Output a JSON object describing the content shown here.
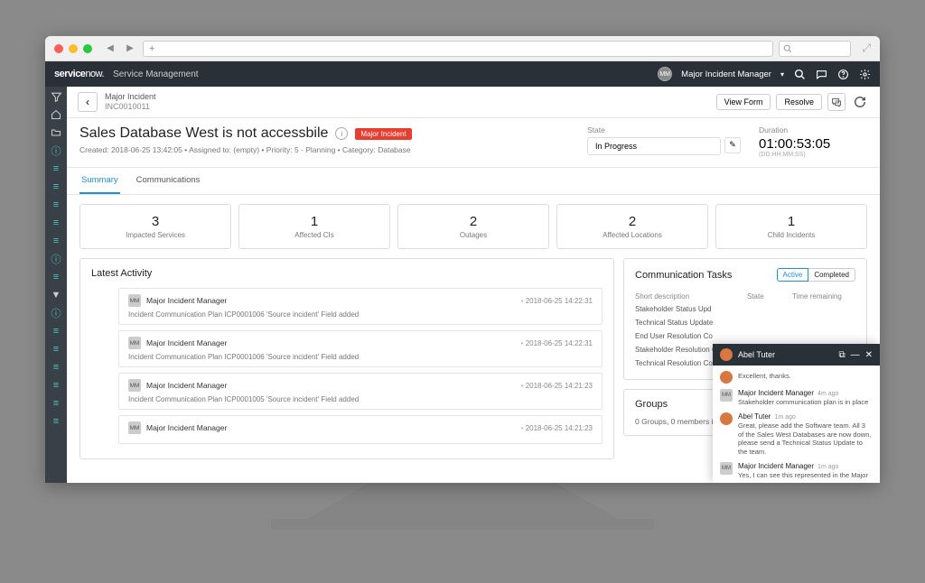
{
  "header": {
    "logo_a": "service",
    "logo_b": "now.",
    "subtitle": "Service Management",
    "user_initials": "MM",
    "user_name": "Major Incident Manager"
  },
  "crumb": {
    "label": "Major Incident",
    "id": "INC0010011"
  },
  "topbar": {
    "view_form": "View Form",
    "resolve": "Resolve"
  },
  "title": "Sales Database West is not accessbile",
  "badge": "Major Incident",
  "meta": "Created: 2018-06-25 13:42:05 • Assigned to: (empty) • Priority: 5 - Planning • Category: Database",
  "state": {
    "label": "State",
    "value": "In Progress"
  },
  "duration": {
    "label": "Duration",
    "value": "01:00:53:05",
    "format": "(DD:HH:MM:SS)"
  },
  "tabs": {
    "summary": "Summary",
    "comms": "Communications"
  },
  "stats": [
    {
      "n": "3",
      "l": "Impacted Services"
    },
    {
      "n": "1",
      "l": "Affected CIs"
    },
    {
      "n": "2",
      "l": "Outages"
    },
    {
      "n": "2",
      "l": "Affected Locations"
    },
    {
      "n": "1",
      "l": "Child Incidents"
    }
  ],
  "activity": {
    "title": "Latest Activity",
    "items": [
      {
        "initials": "MM",
        "user": "Major Incident Manager",
        "time": "2018-06-25 14:22:31",
        "desc": "Incident Communication Plan ICP0001006 'Source incident' Field added"
      },
      {
        "initials": "MM",
        "user": "Major Incident Manager",
        "time": "2018-06-25 14:22:31",
        "desc": "Incident Communication Plan ICP0001006 'Source incident' Field added"
      },
      {
        "initials": "MM",
        "user": "Major Incident Manager",
        "time": "2018-06-25 14:21:23",
        "desc": "Incident Communication Plan ICP0001005 'Source incident' Field added"
      },
      {
        "initials": "MM",
        "user": "Major Incident Manager",
        "time": "2018-06-25 14:21:23",
        "desc": ""
      }
    ]
  },
  "comm": {
    "title": "Communication Tasks",
    "pill_active": "Active",
    "pill_completed": "Completed",
    "th1": "Short description",
    "th2": "State",
    "th3": "Time remaining",
    "rows": [
      "Stakeholder Status Upd",
      "Technical Status Update",
      "End User Resolution Co",
      "Stakeholder Resolution C",
      "Technical Resolution Co"
    ]
  },
  "groups": {
    "title": "Groups",
    "text": "0 Groups, 0 members inv"
  },
  "chat": {
    "title": "Abel Tuter",
    "msgs": [
      {
        "av": "at",
        "user": "",
        "time": "",
        "text": "Excellent, thanks."
      },
      {
        "av": "mm",
        "user": "Major Incident Manager",
        "time": "4m ago",
        "text": "Stakeholder communication plan is in place"
      },
      {
        "av": "at",
        "user": "Abel Tuter",
        "time": "1m ago",
        "text": "Great, please add the Software team. All 3 of the Sales West Databases are now down, please send a Technical Status Update to the team."
      },
      {
        "av": "mm",
        "user": "Major Incident Manager",
        "time": "1m ago",
        "text": "Yes, I can see this represented in the Major"
      }
    ]
  }
}
